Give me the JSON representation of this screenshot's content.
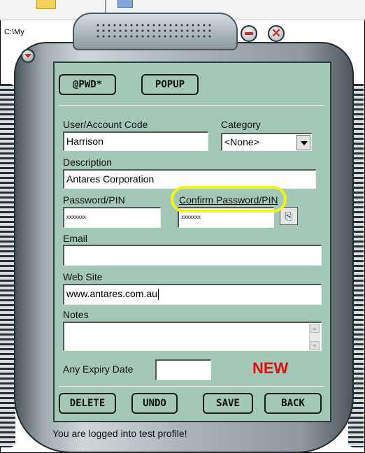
{
  "background": {
    "path_fragment": "C:\\My"
  },
  "toolbar": {
    "pwd_label": "@PWD*",
    "popup_label": "POPUP"
  },
  "form": {
    "user_label": "User/Account Code",
    "user_value": "Harrison",
    "category_label": "Category",
    "category_value": "<None>",
    "description_label": "Description",
    "description_value": "Antares Corporation",
    "password_label": "Password/PIN",
    "password_value": "xxxxxxx",
    "confirm_label": "Confirm Password/PIN",
    "confirm_value": "xxxxxxx",
    "email_label": "Email",
    "email_value": "",
    "website_label": "Web Site",
    "website_value": "www.antares.com.au",
    "notes_label": "Notes",
    "notes_value": "",
    "expiry_label": "Any Expiry Date",
    "expiry_value": "",
    "new_badge": "NEW"
  },
  "actions": {
    "delete_label": "DELETE",
    "undo_label": "UNDO",
    "save_label": "SAVE",
    "back_label": "BACK"
  },
  "status_text": "You are logged into test profile!",
  "colors": {
    "panel_bg": "#a4c8b8",
    "new_badge": "#e01010",
    "highlight": "#f2f21c",
    "device_metal": "#aab4ba"
  },
  "icons": {
    "minimize": "minimize-icon",
    "close": "close-icon",
    "copy": "copy-icon",
    "collapse": "chevron-down-icon"
  }
}
